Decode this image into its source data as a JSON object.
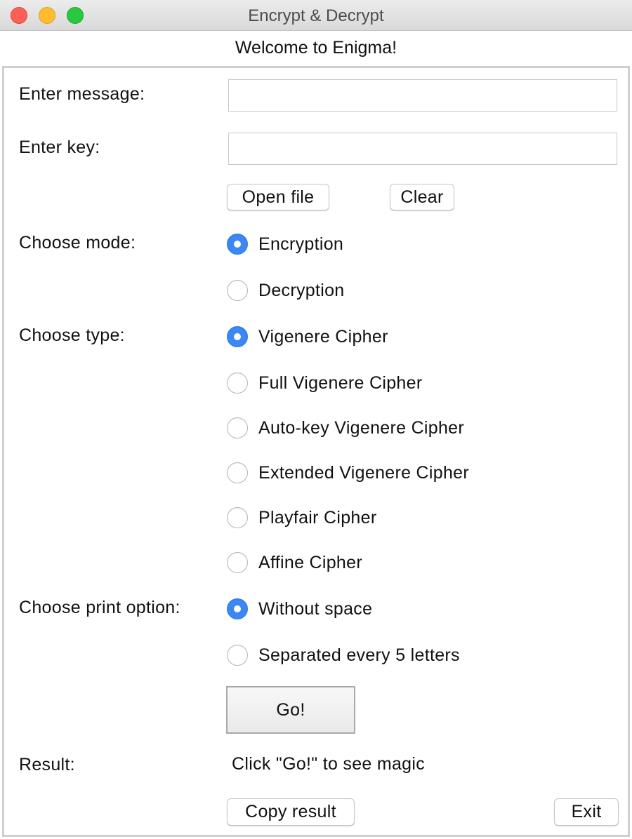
{
  "window": {
    "title": "Encrypt & Decrypt",
    "controls": {
      "close": "close-button",
      "minimize": "minimize-button",
      "maximize": "zoom-button"
    }
  },
  "welcome": "Welcome to Enigma!",
  "form": {
    "message_label": "Enter message:",
    "message_value": "",
    "key_label": "Enter key:",
    "key_value": "",
    "open_file": "Open file",
    "clear": "Clear"
  },
  "mode": {
    "label": "Choose mode:",
    "options": [
      "Encryption",
      "Decryption"
    ],
    "selected": "Encryption"
  },
  "type": {
    "label": "Choose type:",
    "options": [
      "Vigenere Cipher",
      "Full Vigenere Cipher",
      "Auto-key Vigenere Cipher",
      "Extended Vigenere Cipher",
      "Playfair Cipher",
      "Affine Cipher"
    ],
    "selected": "Vigenere Cipher"
  },
  "print": {
    "label": "Choose print option:",
    "options": [
      "Without space",
      "Separated every 5 letters"
    ],
    "selected": "Without space"
  },
  "go": "Go!",
  "result": {
    "label": "Result:",
    "text": "Click \"Go!\" to see magic"
  },
  "copy": "Copy result",
  "exit": "Exit",
  "colors": {
    "accent": "#3b88f5",
    "close": "#fe5f57",
    "minimize": "#febc2e",
    "maximize": "#28c840"
  }
}
